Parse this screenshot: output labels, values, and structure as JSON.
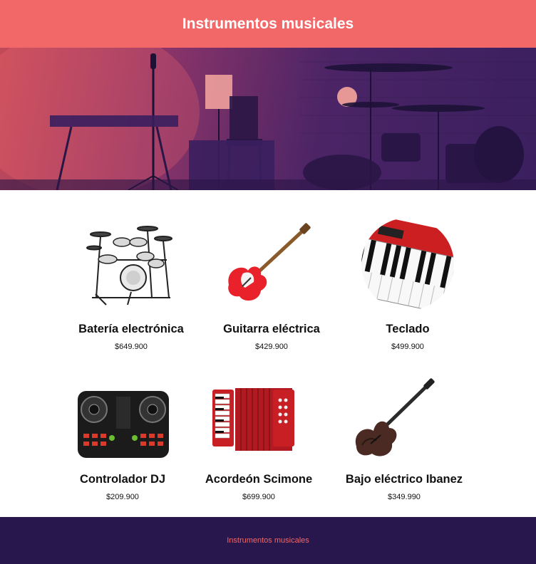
{
  "header": {
    "title": "Instrumentos musicales"
  },
  "hero": {
    "image": "stage-drums-photo",
    "overlay_from": "#e05a5f",
    "overlay_to": "#3a1f5e"
  },
  "products": [
    {
      "name": "Batería electrónica",
      "price": "$649.900",
      "icon": "drum-kit-icon"
    },
    {
      "name": "Guitarra eléctrica",
      "price": "$429.900",
      "icon": "electric-guitar-icon"
    },
    {
      "name": "Teclado",
      "price": "$499.900",
      "icon": "keyboard-icon"
    },
    {
      "name": "Controlador DJ",
      "price": "$209.900",
      "icon": "dj-controller-icon"
    },
    {
      "name": "Acordeón Scimone",
      "price": "$699.900",
      "icon": "accordion-icon"
    },
    {
      "name": "Bajo eléctrico Ibanez",
      "price": "$349.990",
      "icon": "bass-guitar-icon"
    }
  ],
  "footer": {
    "text": "Instrumentos musicales"
  },
  "colors": {
    "header_bg": "#f26868",
    "footer_bg": "#27174c",
    "footer_text": "#f26868"
  }
}
